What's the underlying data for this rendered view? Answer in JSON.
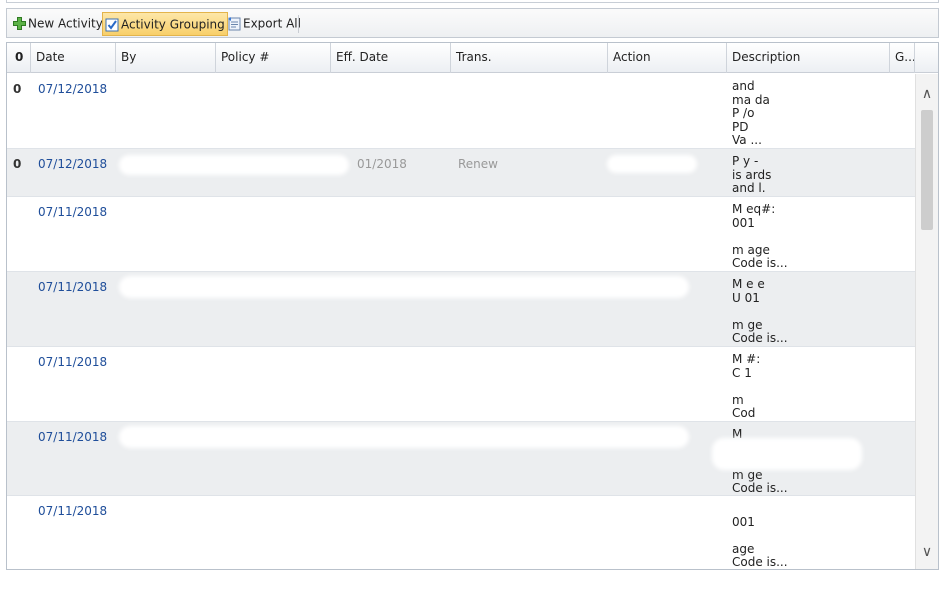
{
  "toolbar": {
    "new_activity": "New Activity",
    "activity_grouping": "Activity Grouping",
    "export_all": "Export All"
  },
  "grid": {
    "columns": [
      "Date",
      "By",
      "Policy #",
      "Eff. Date",
      "Trans.",
      "Action",
      "Description",
      "G..."
    ],
    "attach_header": "0",
    "rows": [
      {
        "clip": "0",
        "date": "07/12/2018",
        "desc": "and\nma             da\nP                /o\nPD\nVa       ..."
      },
      {
        "clip": "0",
        "date": "07/12/2018",
        "eff": "01/2018",
        "trans": "Renew ",
        "desc": "P                   y -\nis                 ards\nand               l."
      },
      {
        "clip": "",
        "date": "07/11/2018",
        "desc": "M            eq#:\n                 001\n\nm             age\nCode is..."
      },
      {
        "clip": "",
        "date": "07/11/2018",
        "desc": "M          e   e\nU                01\n\nm              ge\nCode is..."
      },
      {
        "clip": "",
        "date": "07/11/2018",
        "desc": "M                #:\nC                 1\n\nm\nCod"
      },
      {
        "clip": "",
        "date": "07/11/2018",
        "desc": "M\n\n\nm              ge\nCode is..."
      },
      {
        "clip": "",
        "date": "07/11/2018",
        "desc": "\n                 001\n\n                age\nCode is..."
      }
    ]
  }
}
